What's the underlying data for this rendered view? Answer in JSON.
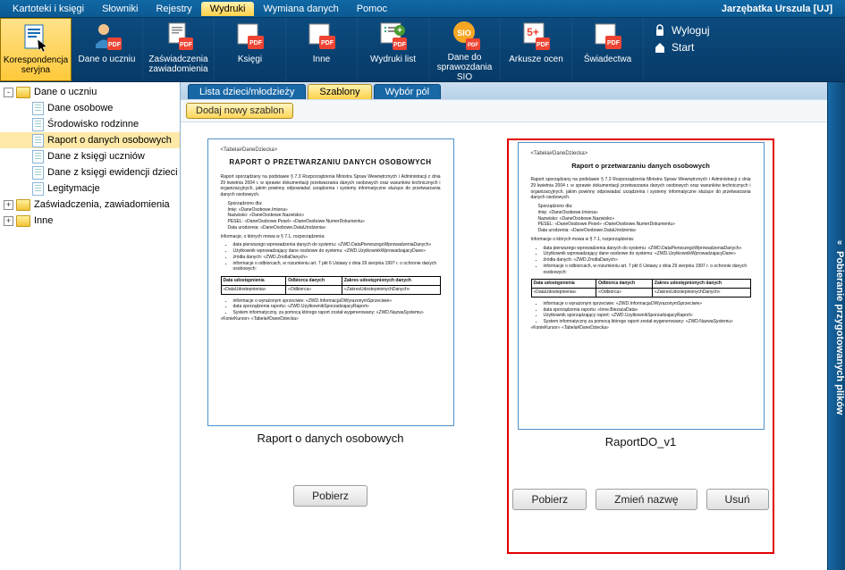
{
  "menubar": {
    "items": [
      {
        "label": "Kartoteki i księgi"
      },
      {
        "label": "Słowniki"
      },
      {
        "label": "Rejestry"
      },
      {
        "label": "Wydruki",
        "active": true
      },
      {
        "label": "Wymiana danych"
      },
      {
        "label": "Pomoc"
      }
    ],
    "user": "Jarzębatka Urszula [UJ]"
  },
  "ribbon": {
    "items": [
      {
        "label": "Korespondencja seryjna",
        "active": true,
        "icon": "doc"
      },
      {
        "label": "Dane o uczniu",
        "icon": "person-pdf"
      },
      {
        "label": "Zaświadczenia zawiadomienia",
        "icon": "doc-pdf"
      },
      {
        "label": "Księgi",
        "icon": "pdf"
      },
      {
        "label": "Inne",
        "icon": "pdf"
      },
      {
        "label": "Wydruki list",
        "icon": "pdf-plus"
      },
      {
        "label": "Dane do sprawozdania SIO",
        "icon": "sio"
      },
      {
        "label": "Arkusze ocen",
        "icon": "grade"
      },
      {
        "label": "Świadectwa",
        "icon": "pdf"
      }
    ],
    "actions": {
      "logout": "Wyloguj",
      "start": "Start"
    }
  },
  "tree": {
    "items": [
      {
        "label": "Dane o uczniu",
        "type": "folder",
        "level": 1,
        "exp": "-"
      },
      {
        "label": "Dane osobowe",
        "type": "page",
        "level": 2
      },
      {
        "label": "Środowisko rodzinne",
        "type": "page",
        "level": 2
      },
      {
        "label": "Raport o danych osobowych",
        "type": "page",
        "level": 2,
        "selected": true
      },
      {
        "label": "Dane z księgi uczniów",
        "type": "page",
        "level": 2
      },
      {
        "label": "Dane z księgi ewidencji dzieci",
        "type": "page",
        "level": 2
      },
      {
        "label": "Legitymacje",
        "type": "page",
        "level": 2
      },
      {
        "label": "Zaświadczenia, zawiadomienia",
        "type": "folder",
        "level": 1,
        "exp": "+"
      },
      {
        "label": "Inne",
        "type": "folder",
        "level": 1,
        "exp": "+"
      }
    ]
  },
  "content_tabs": {
    "items": [
      {
        "label": "Lista dzieci/młodzieży"
      },
      {
        "label": "Szablony",
        "active": true
      },
      {
        "label": "Wybór pól"
      }
    ]
  },
  "toolbar": {
    "new_template": "Dodaj nowy szablon"
  },
  "templates": [
    {
      "title": "Raport o danych osobowych",
      "selected": false,
      "preview_header1": "<Tabela#DaneDziecka>",
      "preview_header2": "RAPORT O PRZETWARZANIU  DANYCH OSOBOWYCH",
      "buttons": {
        "download": "Pobierz"
      }
    },
    {
      "title": "RaportDO_v1",
      "selected": true,
      "preview_header1": "<Tabela#DaneDziecka>",
      "preview_header2": "Raport o przetwarzaniu  danych osobowych",
      "buttons": {
        "download": "Pobierz",
        "rename": "Zmień nazwę",
        "delete": "Usuń"
      }
    }
  ],
  "right_panel": {
    "label": "Pobieranie przygotowanych plików"
  }
}
